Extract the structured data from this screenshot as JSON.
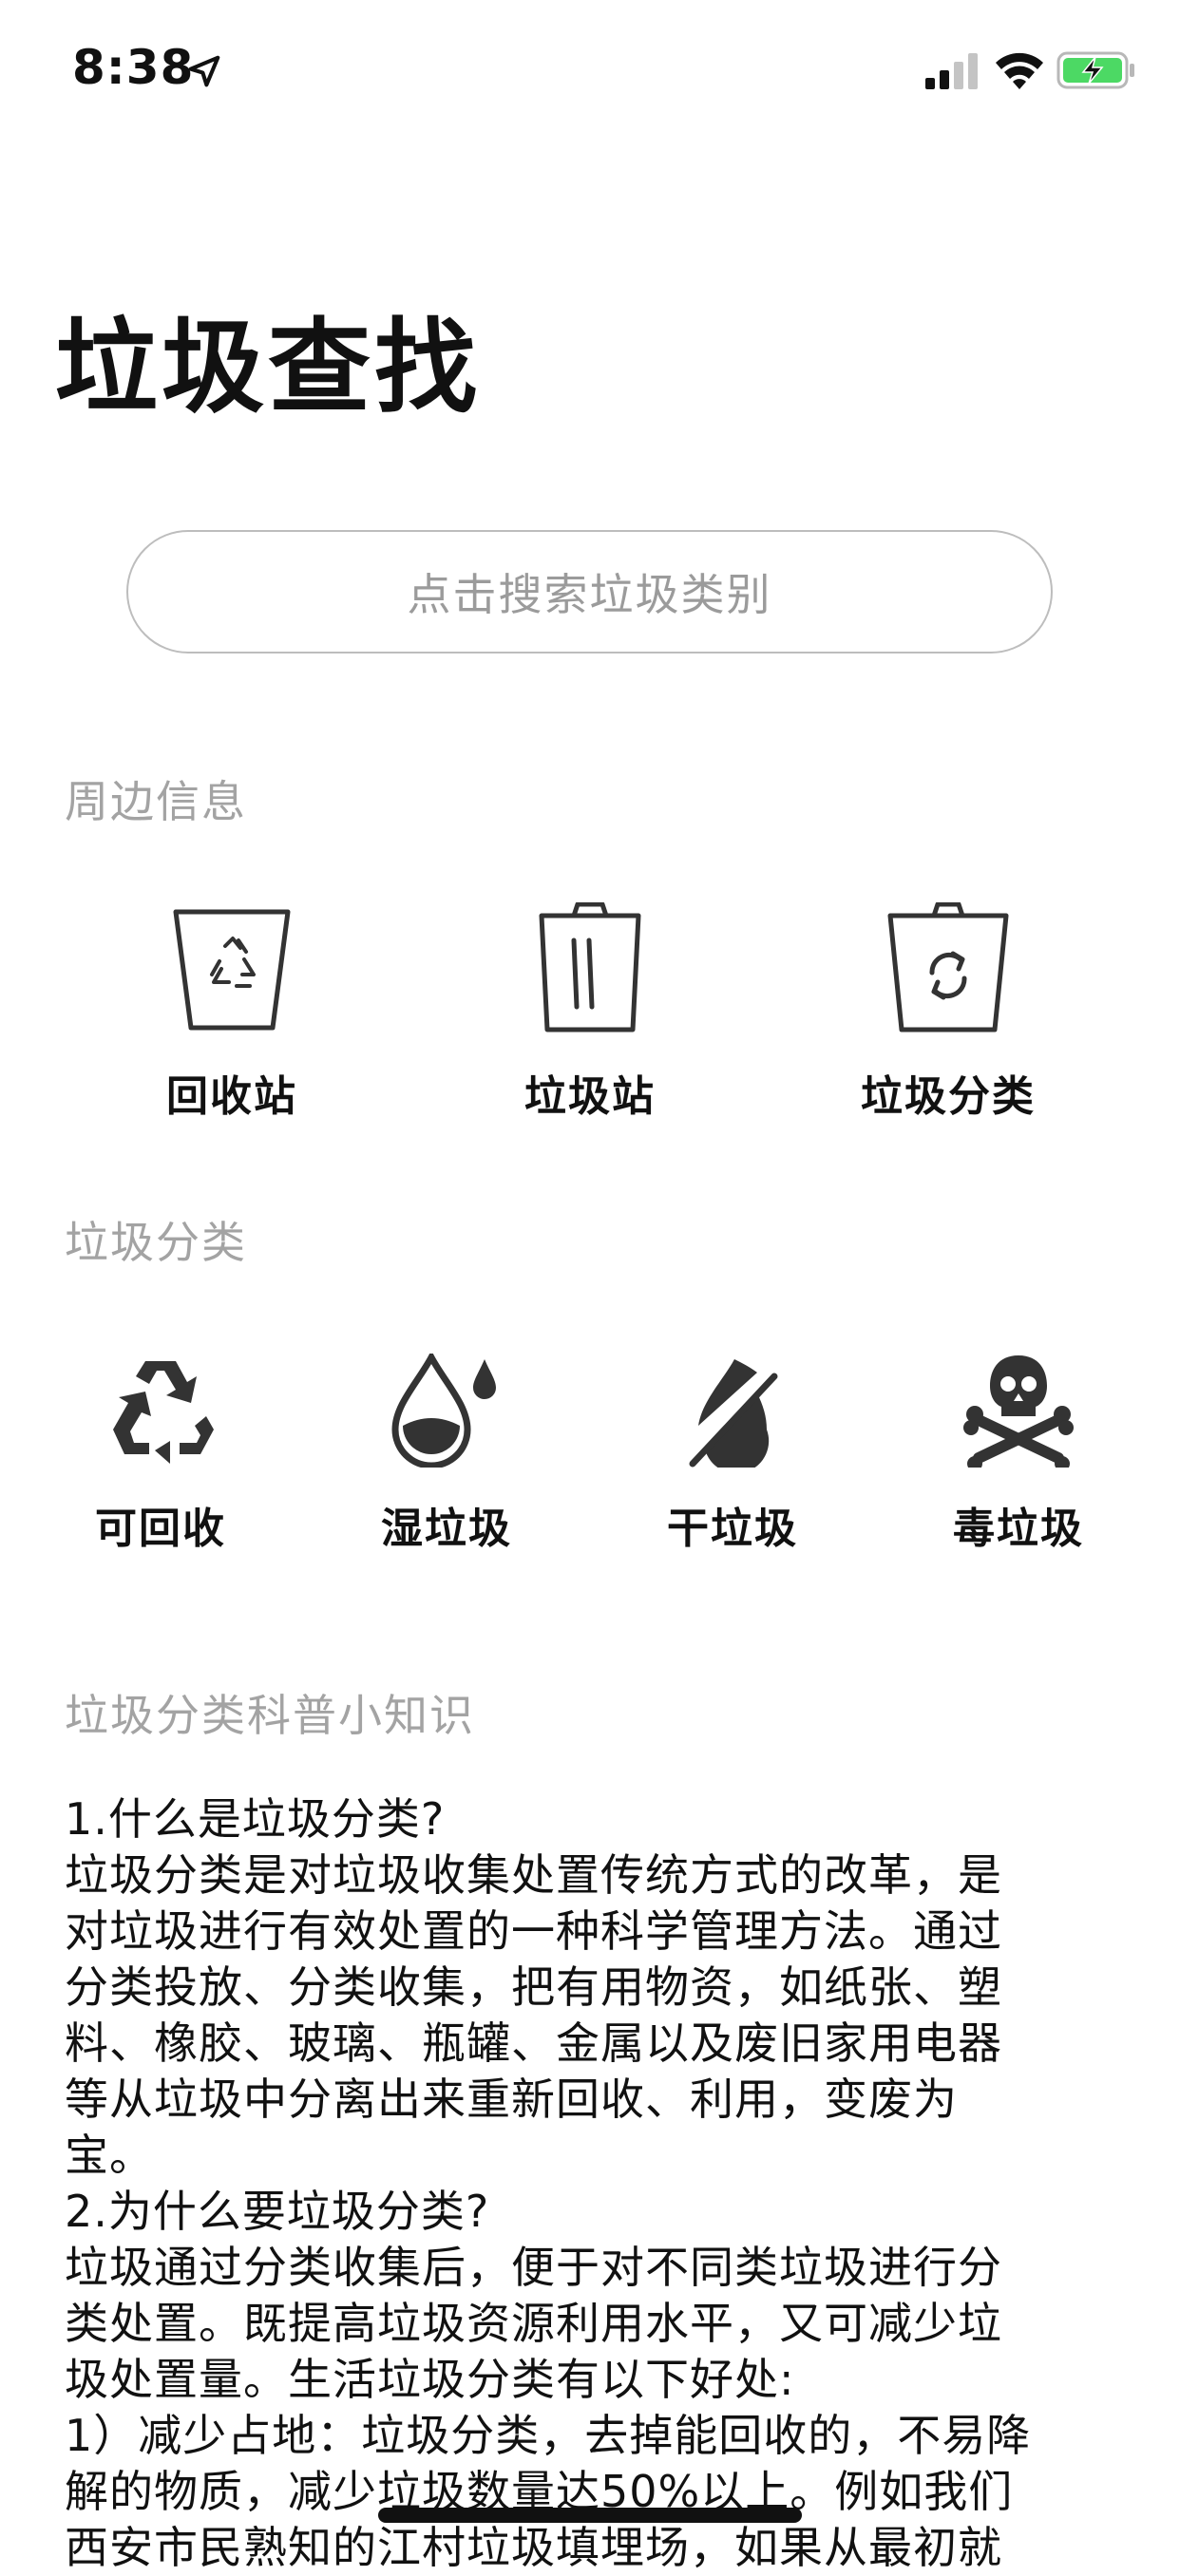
{
  "status_bar": {
    "time": "8:38"
  },
  "header": {
    "title": "垃圾查找"
  },
  "search": {
    "placeholder": "点击搜索垃圾类别"
  },
  "nearby": {
    "label": "周边信息",
    "items": [
      {
        "label": "回收站",
        "icon": "recycle-bin-icon"
      },
      {
        "label": "垃圾站",
        "icon": "trash-bin-icon"
      },
      {
        "label": "垃圾分类",
        "icon": "sort-bin-icon"
      }
    ]
  },
  "categories": {
    "label": "垃圾分类",
    "items": [
      {
        "label": "可回收",
        "icon": "recycle-icon"
      },
      {
        "label": "湿垃圾",
        "icon": "water-drop-icon"
      },
      {
        "label": "干垃圾",
        "icon": "no-water-icon"
      },
      {
        "label": "毒垃圾",
        "icon": "skull-icon"
      }
    ]
  },
  "knowledge": {
    "label": "垃圾分类科普小知识",
    "lines": [
      "1.什么是垃圾分类?",
      "垃圾分类是对垃圾收集处置传统方式的改革，是",
      "对垃圾进行有效处置的一种科学管理方法。通过",
      "分类投放、分类收集，把有用物资，如纸张、塑",
      "料、橡胶、玻璃、瓶罐、金属以及废旧家用电器",
      "等从垃圾中分离出来重新回收、利用，变废为",
      "宝。",
      "2.为什么要垃圾分类?",
      "垃圾通过分类收集后，便于对不同类垃圾进行分",
      "类处置。既提高垃圾资源利用水平，又可减少垃",
      "圾处置量。生活垃圾分类有以下好处:",
      "1）减少占地：垃圾分类，去掉能回收的，不易降",
      "解的物质，减少垃圾数量达50%以上。例如我们",
      "西安市民熟知的江村垃圾填埋场，如果从最初就"
    ]
  }
}
